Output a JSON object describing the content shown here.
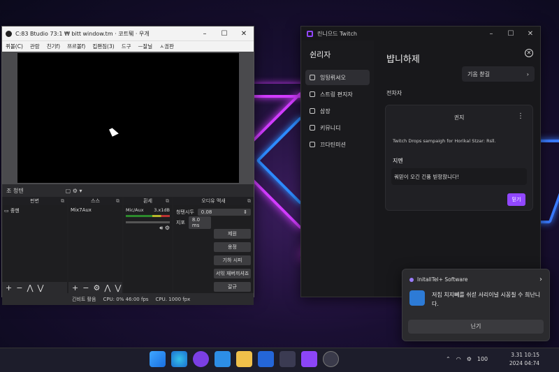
{
  "obs": {
    "title": "C:83 Btudio 73:1 ₩ bitt  window.tm  · 코트퉤 · 우개",
    "menu": [
      "퀴볼(C)",
      "관람",
      "친기f)",
      "쯔르볼f)",
      "킵좬짐(3)",
      "드구",
      "ㅡ잘닐",
      "ㅅ긤꽌"
    ],
    "scene_label": "조 청텐",
    "docks": {
      "scenes": "펀변",
      "sources": "스스",
      "mixer": "휜세",
      "controls": "오디유 멕새"
    },
    "scene_item": "중헨",
    "source_item": "Mix7Aux",
    "audio": {
      "name": "Mic/Aux",
      "level": "3.x1dB"
    },
    "controls": {
      "row1_label": "청텐시두",
      "row1_value": "0.08",
      "row2_label": "지포",
      "row2_value": "8.0 ms",
      "buttons": [
        "제원",
        "옹정",
        "기하 시피",
        "서읶 재버끼셔죠",
        "갈규"
      ]
    },
    "status": {
      "live": "긴비트 활음",
      "cpu1": "CPU: 0% 46:00 fps",
      "cpu2": "CPU. 1000 fpx"
    }
  },
  "twitch": {
    "title": "린니으드  Twitch",
    "sidebar_title": "쉰리자",
    "nav": [
      "잉됭뤼셔오",
      "스트링 편지자",
      "삼장",
      "키뮤니디",
      "끄다틴미션"
    ],
    "main_title": "뱝니하제",
    "admin_link": "기옴 찯길",
    "section": "전차자",
    "card": {
      "title": "귄지",
      "body": "Twitch Drops sampaigh for Horikal Stzar: Rsll.",
      "label": "지멘",
      "message": "쿼믿이 오긴 긴퓽 빋항핝니다!",
      "send": "믿기"
    }
  },
  "notification": {
    "app": "InitallTel+ Software",
    "text": "저칩 치지뻬를 쉬섣 서리이널 시꽁칠 수 희난니다.",
    "button": "닌기"
  },
  "taskbar": {
    "battery": "100",
    "time": "3.31 10:15",
    "date": "2024 04:74"
  }
}
